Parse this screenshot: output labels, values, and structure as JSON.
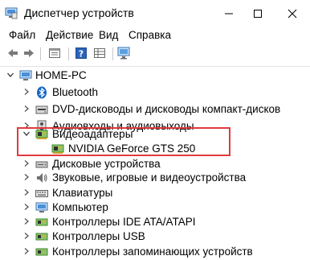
{
  "window": {
    "title": "Диспетчер устройств"
  },
  "menu": {
    "file": "Файл",
    "action": "Действие",
    "view": "Вид",
    "help": "Справка"
  },
  "toolbar": {
    "icons": [
      "back-arrow-icon",
      "forward-arrow-icon",
      "properties-icon",
      "help-icon",
      "grid-view-icon",
      "monitor-scan-icon"
    ]
  },
  "tree": {
    "root": {
      "label": "HOME-PC",
      "expanded": true
    },
    "items": [
      {
        "label": "Bluetooth",
        "icon": "bluetooth-icon",
        "expanded": false
      },
      {
        "label": "DVD-дисководы и дисководы компакт-дисков",
        "icon": "dvd-drive-icon",
        "expanded": false
      },
      {
        "label": "Аудиовходы и аудиовыходы",
        "icon": "speaker-icon",
        "expanded": false
      },
      {
        "label": "Видеоадаптеры",
        "icon": "display-adapter-icon",
        "expanded": true,
        "children": [
          {
            "label": "NVIDIA GeForce GTS 250",
            "icon": "display-adapter-icon"
          }
        ]
      },
      {
        "label": "Дисковые устройства",
        "icon": "disk-drive-icon",
        "expanded": false
      },
      {
        "label": "Звуковые, игровые и видеоустройства",
        "icon": "sound-icon",
        "expanded": false
      },
      {
        "label": "Клавиатуры",
        "icon": "keyboard-icon",
        "expanded": false
      },
      {
        "label": "Компьютер",
        "icon": "computer-icon",
        "expanded": false
      },
      {
        "label": "Контроллеры IDE ATA/ATAPI",
        "icon": "ide-controller-icon",
        "expanded": false
      },
      {
        "label": "Контроллеры USB",
        "icon": "usb-controller-icon",
        "expanded": false
      },
      {
        "label": "Контроллеры запоминающих устройств",
        "icon": "storage-controller-icon",
        "expanded": false
      }
    ]
  },
  "colors": {
    "highlight_border": "#e23a3e",
    "bluetooth_blue": "#1565c0",
    "adapter_green": "#3c8a2e"
  }
}
